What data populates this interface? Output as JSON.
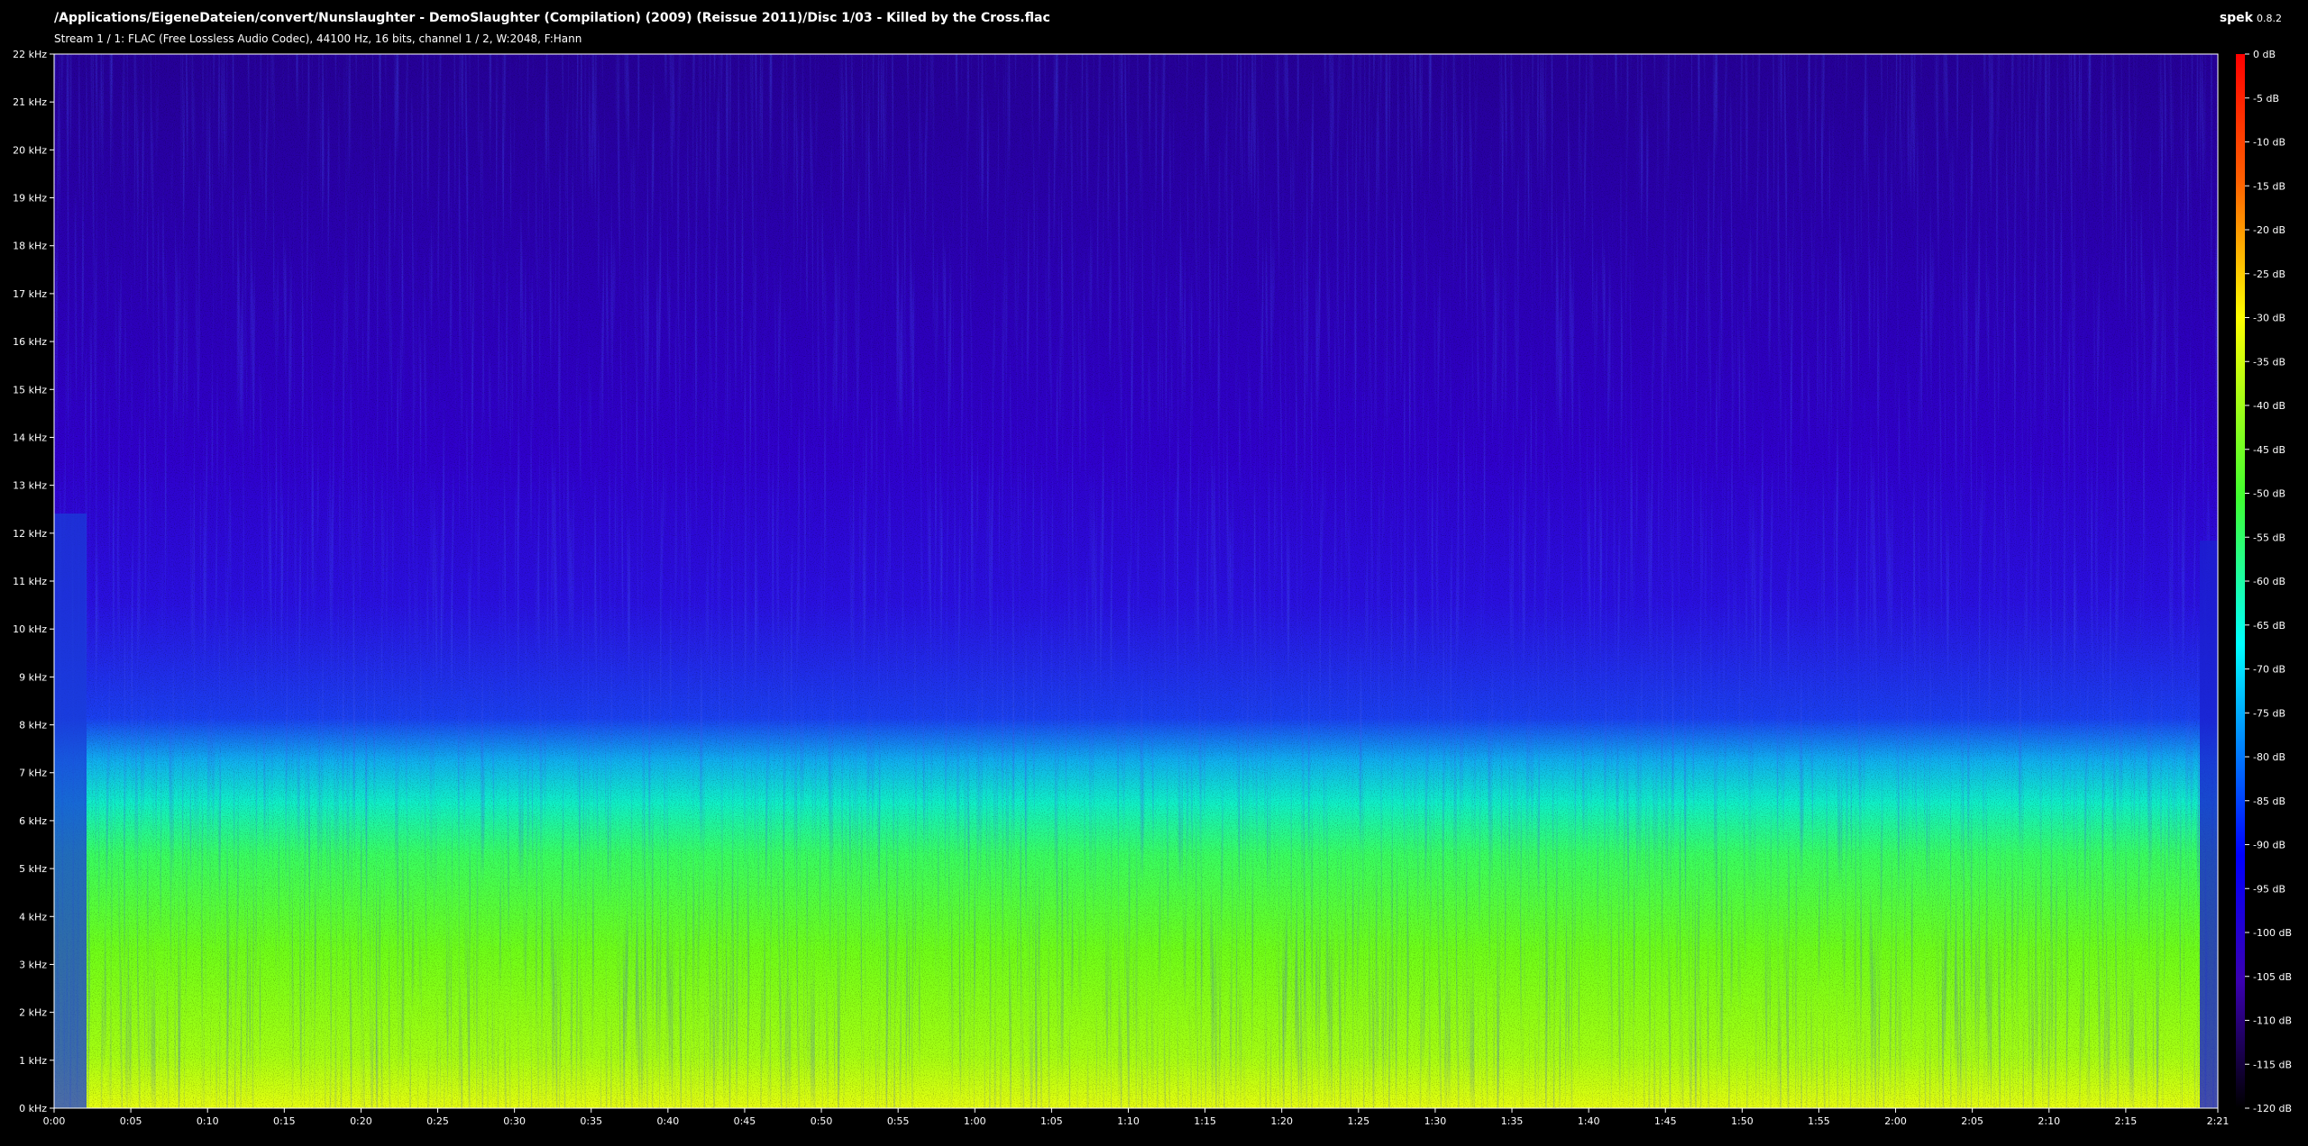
{
  "header": {
    "file_path": "/Applications/EigeneDateien/convert/Nunslaughter - DemoSlaughter (Compilation) (2009) (Reissue 2011)/Disc 1/03 - Killed by the Cross.flac",
    "stream_info": "Stream 1 / 1: FLAC (Free Lossless Audio Codec), 44100 Hz, 16 bits, channel 1 / 2, W:2048, F:Hann",
    "app_name": "spek",
    "app_version": "0.8.2"
  },
  "chart_data": {
    "type": "heatmap",
    "title": "",
    "xlabel": "",
    "ylabel": "",
    "xlim_seconds": [
      0,
      141
    ],
    "ylim_khz": [
      0,
      22
    ],
    "x_ticks": [
      "0:00",
      "0:05",
      "0:10",
      "0:15",
      "0:20",
      "0:25",
      "0:30",
      "0:35",
      "0:40",
      "0:45",
      "0:50",
      "0:55",
      "1:00",
      "1:05",
      "1:10",
      "1:15",
      "1:20",
      "1:25",
      "1:30",
      "1:35",
      "1:40",
      "1:45",
      "1:50",
      "1:55",
      "2:00",
      "2:05",
      "2:10",
      "2:15"
    ],
    "x_end_label": "2:21",
    "y_ticks": [
      "0 kHz",
      "1 kHz",
      "2 kHz",
      "3 kHz",
      "4 kHz",
      "5 kHz",
      "6 kHz",
      "7 kHz",
      "8 kHz",
      "9 kHz",
      "10 kHz",
      "11 kHz",
      "12 kHz",
      "13 kHz",
      "14 kHz",
      "15 kHz",
      "16 kHz",
      "17 kHz",
      "18 kHz",
      "19 kHz",
      "20 kHz",
      "21 kHz",
      "22 kHz"
    ],
    "db_ticks": [
      "0 dB",
      "-5 dB",
      "-10 dB",
      "-15 dB",
      "-20 dB",
      "-25 dB",
      "-30 dB",
      "-35 dB",
      "-40 dB",
      "-45 dB",
      "-50 dB",
      "-55 dB",
      "-60 dB",
      "-65 dB",
      "-70 dB",
      "-75 dB",
      "-80 dB",
      "-85 dB",
      "-90 dB",
      "-95 dB",
      "-100 dB",
      "-105 dB",
      "-110 dB",
      "-115 dB",
      "-120 dB"
    ],
    "db_range": [
      -120,
      0
    ],
    "colormap": [
      "#ff0000",
      "#ff8000",
      "#ffff00",
      "#80ff00",
      "#00ff80",
      "#00ffff",
      "#0080ff",
      "#0000ff",
      "#4000cc",
      "#200060",
      "#000000"
    ],
    "background": "#000000",
    "energy_profile_note_free": true
  }
}
